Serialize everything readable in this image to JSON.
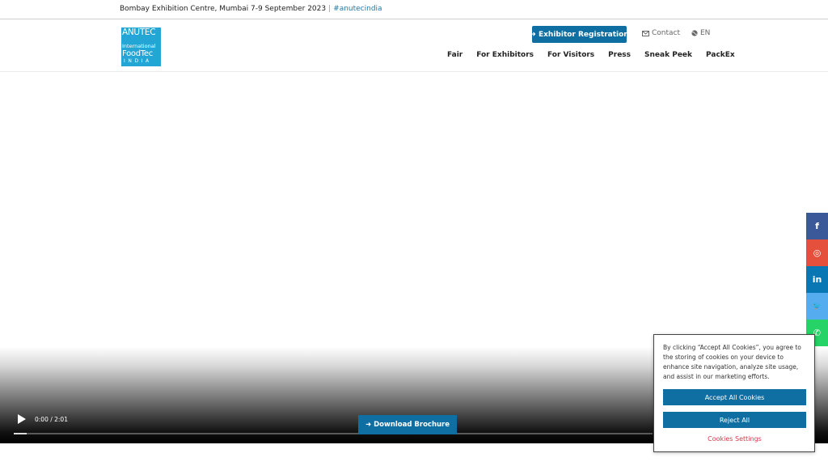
{
  "topbar": {
    "event_info": "Bombay Exhibition Centre, Mumbai 7-9 September 2023",
    "separator": "|",
    "hashtag": "#anutecindia"
  },
  "logo": {
    "line1": "ANUTEC",
    "line2": "International",
    "line3": "FoodTec",
    "line4": "INDIA"
  },
  "header": {
    "register_button": "➜ Exhibitor Registration",
    "contact": "Contact",
    "language": "EN"
  },
  "nav": {
    "items": [
      "Fair",
      "For Exhibitors",
      "For Visitors",
      "Press",
      "Sneak Peek",
      "PackEx"
    ]
  },
  "video": {
    "time": "0:00 / 2:01",
    "progress": 0.02,
    "brochure_button": "➜ Download Brochure"
  },
  "social": {
    "items": [
      {
        "icon": "facebook-icon",
        "glyph": "f",
        "color": "#3b5998"
      },
      {
        "icon": "instagram-icon",
        "glyph": "◎",
        "color": "#e4503b"
      },
      {
        "icon": "linkedin-icon",
        "glyph": "in",
        "color": "#0a77b5"
      },
      {
        "icon": "twitter-icon",
        "glyph": "🐦",
        "color": "#55acee"
      },
      {
        "icon": "whatsapp-icon",
        "glyph": "✆",
        "color": "#25d366"
      }
    ]
  },
  "cookie": {
    "text": "By clicking “Accept All Cookies”, you agree to the storing of cookies on your device to enhance site navigation, analyze site usage, and assist in our marketing efforts.",
    "accept_button": "Accept All Cookies",
    "reject_button": "Reject All",
    "settings_link": "Cookies Settings"
  },
  "colors": {
    "primary": "#0f6fa3",
    "link": "#1d78a8",
    "cookie_settings": "#d6394a"
  }
}
